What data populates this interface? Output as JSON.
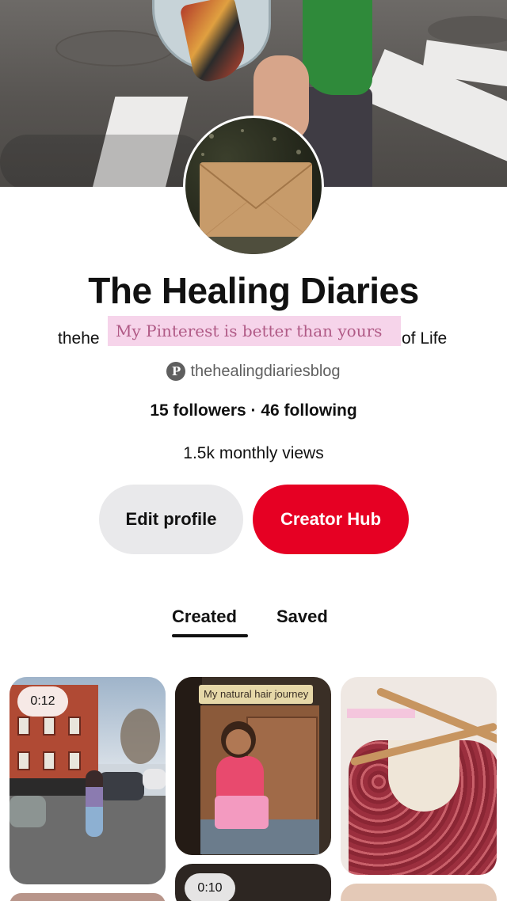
{
  "profile": {
    "name": "The Healing Diaries",
    "bio_visible_left": "thehe",
    "bio_visible_right": "of Life",
    "sticker_text": "My Pinterest is better than yours",
    "handle": "thehealingdiariesblog",
    "handle_icon": "pinterest-p-icon",
    "follow_stats": "15 followers · 46 following",
    "monthly_views": "1.5k monthly views"
  },
  "buttons": {
    "edit_profile": "Edit profile",
    "creator_hub": "Creator Hub"
  },
  "tabs": {
    "created": "Created",
    "saved": "Saved",
    "active": "Created"
  },
  "pins": [
    {
      "duration": "0:12",
      "caption": ""
    },
    {
      "duration": "",
      "caption": "My natural hair journey"
    },
    {
      "duration": "",
      "caption": ""
    },
    {
      "duration": "0:10",
      "caption": ""
    }
  ],
  "colors": {
    "creator_hub_bg": "#e60023",
    "edit_profile_bg": "#e9e9eb",
    "sticker_bg": "#f6d4ea",
    "sticker_text": "#b05a86"
  }
}
